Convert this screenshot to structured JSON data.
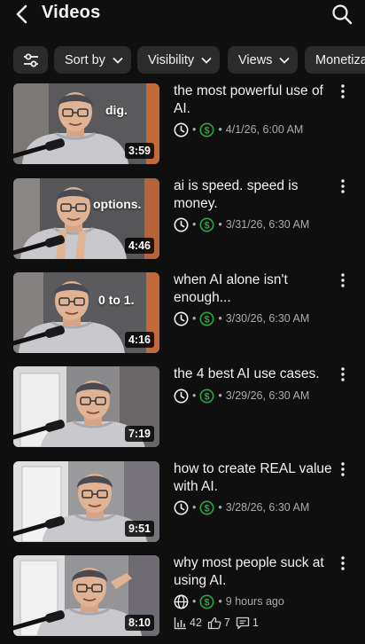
{
  "header": {
    "title": "Videos"
  },
  "filters": {
    "sort_label": "Sort by",
    "visibility_label": "Visibility",
    "views_label": "Views",
    "monetization_label": "Monetiza"
  },
  "videos": [
    {
      "title": "the most powerful use of AI.",
      "duration": "3:59",
      "overlay": "dig.",
      "date": "4/1/26, 6:00 AM",
      "status_icon": "clock-icon",
      "monetization_icon": "dollar-circle-icon"
    },
    {
      "title": "ai is speed. speed is money.",
      "duration": "4:46",
      "overlay": "options.",
      "date": "3/31/26, 6:30 AM",
      "status_icon": "clock-icon",
      "monetization_icon": "dollar-circle-icon"
    },
    {
      "title": "when AI alone isn't enough...",
      "duration": "4:16",
      "overlay": "0 to 1.",
      "date": "3/30/26, 6:30 AM",
      "status_icon": "clock-icon",
      "monetization_icon": "dollar-circle-icon"
    },
    {
      "title": "the 4 best AI use cases.",
      "duration": "7:19",
      "overlay": "",
      "date": "3/29/26, 6:30 AM",
      "status_icon": "clock-icon",
      "monetization_icon": "dollar-circle-icon"
    },
    {
      "title": "how to create REAL value with AI.",
      "duration": "9:51",
      "overlay": "",
      "date": "3/28/26, 6:30 AM",
      "status_icon": "clock-icon",
      "monetization_icon": "dollar-circle-icon"
    },
    {
      "title": "why most people suck at using AI.",
      "duration": "8:10",
      "overlay": "",
      "date": "9 hours ago",
      "status_icon": "globe-icon",
      "monetization_icon": "dollar-circle-icon",
      "stats": {
        "views": "42",
        "likes": "7",
        "comments": "1"
      }
    }
  ],
  "colors": {
    "background": "#0f0f0f",
    "chip": "#2b2b2b",
    "monetization_green": "#2ba640",
    "meta_text": "#aaaaaa"
  }
}
